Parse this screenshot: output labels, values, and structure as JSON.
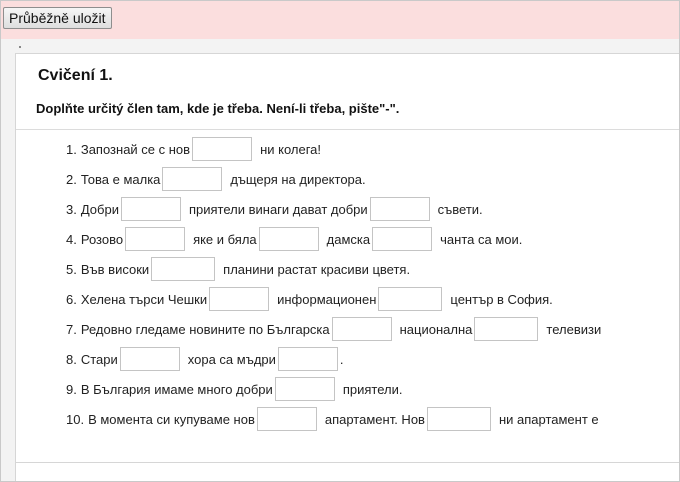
{
  "toolbar": {
    "save_label": "Průběžně uložit"
  },
  "exercise": {
    "title": "Cvičení 1.",
    "instruction": "Doplňte určitý člen tam, kde je třeba. Není-li třeba, pište\"-\".",
    "items": [
      {
        "n": "1.",
        "parts": [
          "Запознай се с нов",
          "ни колега!"
        ]
      },
      {
        "n": "2.",
        "parts": [
          "Това е малка",
          "дъщеря на директора."
        ]
      },
      {
        "n": "3.",
        "parts": [
          "Добри",
          "приятели винаги дават добри",
          "съвети."
        ]
      },
      {
        "n": "4.",
        "parts": [
          "Розово",
          "яке и бяла",
          "дамска",
          "чанта са мои."
        ]
      },
      {
        "n": "5.",
        "parts": [
          "Във високи",
          "планини растат красиви цветя."
        ]
      },
      {
        "n": "6.",
        "parts": [
          "Хелена търси Чешки",
          "информационен",
          "център в София."
        ]
      },
      {
        "n": "7.",
        "parts": [
          "Редовно гледаме новините по Българска",
          "национална",
          "телевизи"
        ]
      },
      {
        "n": "8.",
        "parts": [
          "Стари",
          "хора са мъдри",
          "."
        ]
      },
      {
        "n": "9.",
        "parts": [
          "В България имаме много добри",
          "приятели."
        ]
      },
      {
        "n": "10.",
        "parts": [
          "В момента си купуваме нов",
          "апартамент. Нов",
          "ни апартамент е"
        ]
      }
    ]
  }
}
